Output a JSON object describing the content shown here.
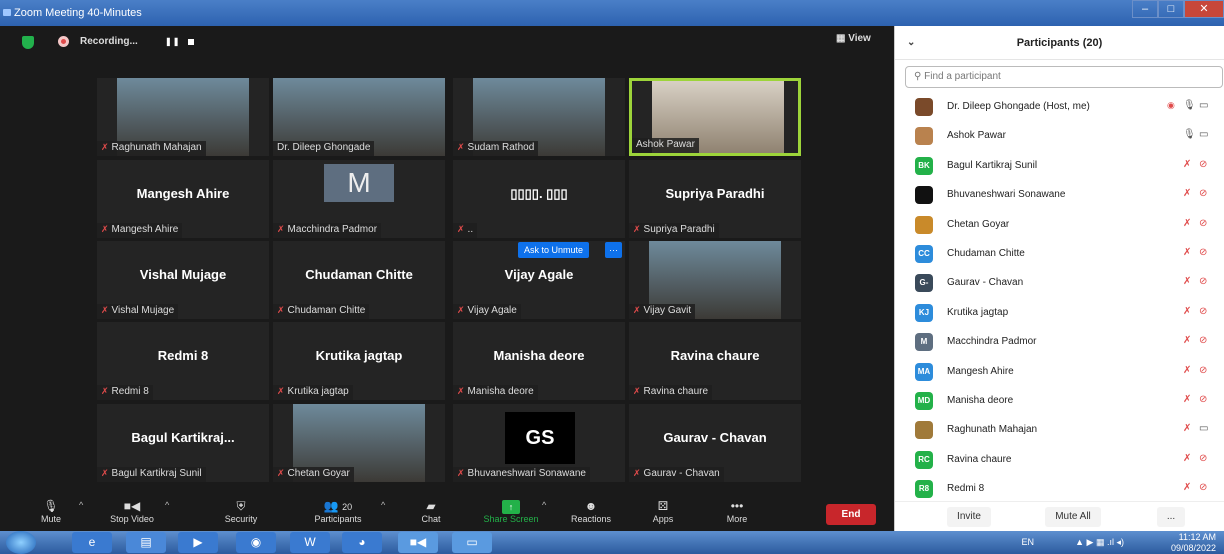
{
  "window": {
    "title": "Zoom Meeting 40-Minutes",
    "min": "‒",
    "max": "□",
    "close": "✕"
  },
  "topbar": {
    "recording": "Recording...",
    "pause": "❚❚",
    "view": "▦ View"
  },
  "tiles": [
    {
      "label": "Raghunath Mahajan",
      "type": "photo",
      "muted": true
    },
    {
      "label": "Dr. Dileep Ghongade",
      "type": "photo-full",
      "muted": false
    },
    {
      "label": "Sudam Rathod",
      "type": "photo",
      "muted": true
    },
    {
      "label": "Ashok Pawar",
      "type": "photo-active",
      "muted": false
    },
    {
      "name": "Mangesh Ahire",
      "label": "Mangesh Ahire",
      "type": "name",
      "muted": true
    },
    {
      "avatar": "M",
      "label": "Macchindra Padmor",
      "type": "avatar",
      "muted": true
    },
    {
      "name": "▯▯▯▯. ▯▯▯",
      "label": "..",
      "type": "name",
      "muted": true
    },
    {
      "name": "Supriya Paradhi",
      "label": "Supriya Paradhi",
      "type": "name",
      "muted": true
    },
    {
      "name": "Vishal Mujage",
      "label": "Vishal Mujage",
      "type": "name",
      "muted": true
    },
    {
      "name": "Chudaman Chitte",
      "label": "Chudaman Chitte",
      "type": "name",
      "muted": true
    },
    {
      "name": "Vijay Agale",
      "label": "Vijay Agale",
      "type": "name",
      "muted": true
    },
    {
      "label": "Vijay Gavit",
      "type": "photo",
      "muted": true
    },
    {
      "name": "Redmi 8",
      "label": "Redmi 8",
      "type": "name",
      "muted": true
    },
    {
      "name": "Krutika jagtap",
      "label": "Krutika jagtap",
      "type": "name",
      "muted": true
    },
    {
      "name": "Manisha deore",
      "label": "Manisha deore",
      "type": "name",
      "muted": true
    },
    {
      "name": "Ravina  chaure",
      "label": "Ravina  chaure",
      "type": "name",
      "muted": true
    },
    {
      "name": "Bagul Kartikraj...",
      "label": "Bagul Kartikraj Sunil",
      "type": "name",
      "muted": true
    },
    {
      "label": "Chetan Goyar",
      "type": "photo",
      "muted": true
    },
    {
      "logo": "GS",
      "label": "Bhuvaneshwari Sonawane",
      "type": "logo",
      "muted": true
    },
    {
      "name": "Gaurav - Chavan",
      "label": "Gaurav - Chavan",
      "type": "name",
      "muted": true
    }
  ],
  "ask_unmute": {
    "label": "Ask to Unmute",
    "more": "···"
  },
  "toolbar": {
    "mute": "Mute",
    "stop_video": "Stop Video",
    "security": "Security",
    "participants": "Participants",
    "participants_count": "20",
    "chat": "Chat",
    "share_screen": "Share Screen",
    "reactions": "Reactions",
    "apps": "Apps",
    "more": "More",
    "end": "End"
  },
  "panel": {
    "title": "Participants (20)",
    "search_placeholder": "Find a participant",
    "participants": [
      {
        "initials": "",
        "color": "#7a4a2a",
        "name": "Dr. Dileep Ghongade (Host, me)",
        "mic": "on",
        "cam": "on",
        "rec": true
      },
      {
        "initials": "",
        "color": "#b9824e",
        "name": "Ashok Pawar",
        "mic": "on",
        "cam": "on"
      },
      {
        "initials": "BK",
        "color": "#23b149",
        "name": "Bagul Kartikraj Sunil",
        "mic": "off",
        "cam": "off"
      },
      {
        "initials": "",
        "color": "#111111",
        "name": "Bhuvaneshwari Sonawane",
        "mic": "off",
        "cam": "off"
      },
      {
        "initials": "",
        "color": "#c98a2a",
        "name": "Chetan Goyar",
        "mic": "off",
        "cam": "off"
      },
      {
        "initials": "CC",
        "color": "#2d8cdb",
        "name": "Chudaman Chitte",
        "mic": "off",
        "cam": "off"
      },
      {
        "initials": "G-",
        "color": "#3a4a5a",
        "name": "Gaurav - Chavan",
        "mic": "off",
        "cam": "off"
      },
      {
        "initials": "KJ",
        "color": "#2d8cdb",
        "name": "Krutika jagtap",
        "mic": "off",
        "cam": "off"
      },
      {
        "initials": "M",
        "color": "#5e6e80",
        "name": "Macchindra Padmor",
        "mic": "off",
        "cam": "off"
      },
      {
        "initials": "MA",
        "color": "#2d8cdb",
        "name": "Mangesh Ahire",
        "mic": "off",
        "cam": "off"
      },
      {
        "initials": "MD",
        "color": "#23b149",
        "name": "Manisha deore",
        "mic": "off",
        "cam": "off"
      },
      {
        "initials": "",
        "color": "#a07a3a",
        "name": "Raghunath Mahajan",
        "mic": "off",
        "cam": "on"
      },
      {
        "initials": "RC",
        "color": "#23b149",
        "name": "Ravina  chaure",
        "mic": "off",
        "cam": "off"
      },
      {
        "initials": "R8",
        "color": "#23b149",
        "name": "Redmi 8",
        "mic": "off",
        "cam": "off"
      }
    ],
    "invite": "Invite",
    "mute_all": "Mute All",
    "more": "..."
  },
  "taskbar": {
    "lang": "EN",
    "time": "11:12 AM",
    "date": "09/08/2022"
  }
}
